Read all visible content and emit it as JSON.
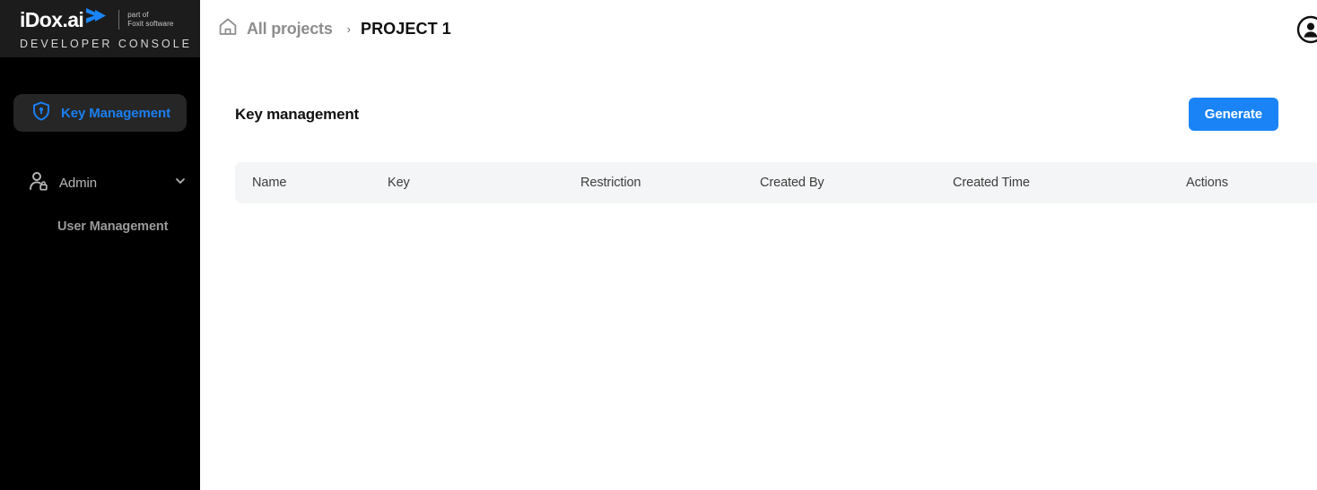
{
  "sidebar": {
    "logo": {
      "wordmark": "iDox.ai",
      "arrow_icon": "arrow-mark-icon",
      "tagline_line1": "part of",
      "tagline_line2": "Foxit software",
      "product_line": "DEVELOPER  CONSOLE"
    },
    "items": [
      {
        "label": "Key Management",
        "icon": "shield-key-icon",
        "active": true,
        "name": "sidebar-item-key-management"
      },
      {
        "label": "Admin",
        "icon": "user-lock-icon",
        "chevron": "chevron-down-icon",
        "active": false,
        "name": "sidebar-item-admin"
      },
      {
        "label": "User Management",
        "active": false,
        "name": "sidebar-item-user-management"
      }
    ]
  },
  "topbar": {
    "home_icon": "home-icon",
    "breadcrumb_root": "All projects",
    "breadcrumb_separator": "›",
    "breadcrumb_current": "PROJECT 1",
    "account_icon": "account-circle-icon"
  },
  "main": {
    "page_title": "Key management",
    "generate_label": "Generate",
    "table": {
      "columns": [
        "Name",
        "Key",
        "Restriction",
        "Created By",
        "Created Time",
        "Actions"
      ],
      "rows": []
    }
  },
  "colors": {
    "accent_blue": "#1a84f7",
    "nav_active_blue": "#1a7ff0",
    "sidebar_bg": "#000000",
    "logo_bg": "#1c1c1c",
    "nav_active_bg": "#262626",
    "table_header_bg": "#f4f5f6"
  }
}
